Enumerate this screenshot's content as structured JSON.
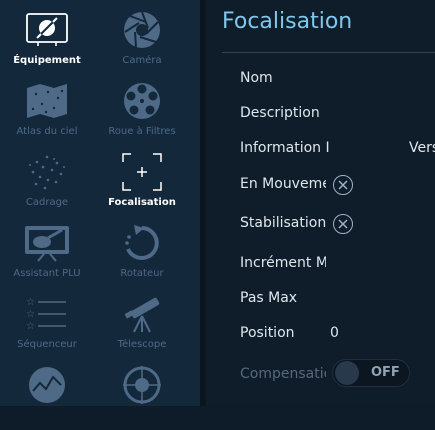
{
  "sidebar": {
    "items": [
      {
        "label": "Équipement",
        "icon": "equipment-icon"
      },
      {
        "label": "Caméra",
        "icon": "camera-aperture-icon"
      },
      {
        "label": "Atlas du ciel",
        "icon": "sky-atlas-map-icon"
      },
      {
        "label": "Roue à Filtres",
        "icon": "filter-wheel-icon"
      },
      {
        "label": "Cadrage",
        "icon": "framing-stars-icon"
      },
      {
        "label": "Focalisation",
        "icon": "focus-crosshair-icon"
      },
      {
        "label": "Assistant PLU",
        "icon": "flat-panel-icon"
      },
      {
        "label": "Rotateur",
        "icon": "rotator-icon"
      },
      {
        "label": "Séquenceur",
        "icon": "sequencer-list-icon"
      },
      {
        "label": "Télescope",
        "icon": "telescope-icon"
      }
    ],
    "active": "Focalisation"
  },
  "main": {
    "title": "Focalisation",
    "fields": {
      "name_label": "Nom",
      "description_label": "Description",
      "information_label": "Information I",
      "information_value": "Vers",
      "moving_label": "En Mouveme",
      "settling_label": "Stabilisation",
      "step_size_label": "Incrément M",
      "max_step_label": "Pas Max",
      "position_label": "Position",
      "position_value": "0",
      "compensation_label": "Compensatic",
      "compensation_toggle": "OFF"
    }
  },
  "colors": {
    "accent": "#7ec8ee",
    "sidebar_bg": "#14283c",
    "main_bg": "#0f1c29"
  }
}
